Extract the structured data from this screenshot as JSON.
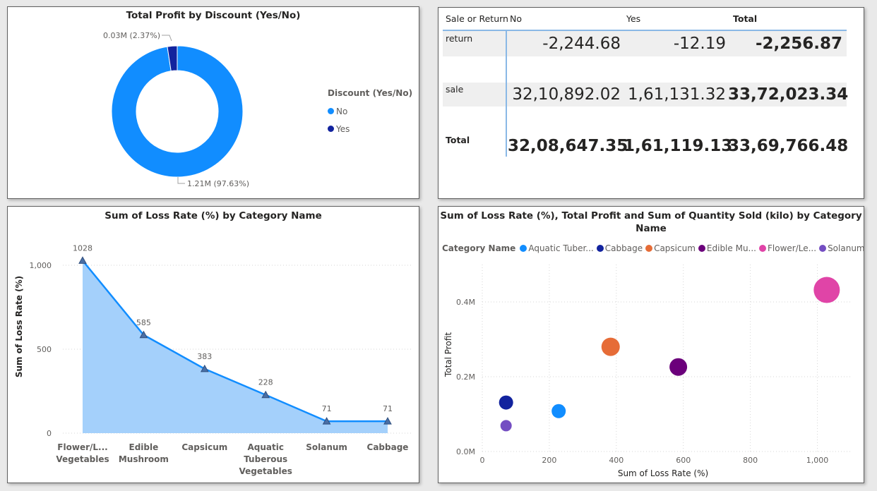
{
  "donut": {
    "title": "Total Profit by Discount (Yes/No)",
    "legend_title": "Discount (Yes/No)",
    "chart_data": {
      "type": "pie",
      "title": "Total Profit by Discount (Yes/No)",
      "legend_position": "right",
      "categories": [
        "No",
        "Yes"
      ],
      "values": [
        1.21,
        0.03
      ],
      "percent": [
        97.63,
        2.37
      ],
      "labels": [
        "1.21M (97.63%)",
        "0.03M (2.37%)"
      ],
      "colors": [
        "#118DFF",
        "#12239E"
      ]
    }
  },
  "matrix": {
    "header": [
      "Sale or Return",
      "No",
      "Yes",
      "Total"
    ],
    "rows": [
      {
        "label": "return",
        "cells": [
          "-2,244.68",
          "-12.19",
          "-2,256.87"
        ]
      },
      {
        "label": "sale",
        "cells": [
          "32,10,892.02",
          "1,61,131.32",
          "33,72,023.34"
        ]
      },
      {
        "label": "Total",
        "cells": [
          "32,08,647.35",
          "1,61,119.13",
          "33,69,766.48"
        ]
      }
    ]
  },
  "area": {
    "title": "Sum of Loss Rate (%) by Category Name",
    "chart_data": {
      "type": "area",
      "title": "Sum of Loss Rate (%) by Category Name",
      "ylabel": "Sum of Loss Rate (%)",
      "xlabel": "",
      "categories": [
        [
          "Flower/L...",
          "Vegetables"
        ],
        [
          "Edible",
          "Mushroom"
        ],
        [
          "Capsicum"
        ],
        [
          "Aquatic",
          "Tuberous",
          "Vegetables"
        ],
        [
          "Solanum"
        ],
        [
          "Cabbage"
        ]
      ],
      "values": [
        1028,
        585,
        383,
        228,
        71,
        71
      ],
      "data_labels": [
        "1028",
        "585",
        "383",
        "228",
        "71",
        "71"
      ],
      "ylim": [
        0,
        1000
      ],
      "yticks": [
        0,
        500,
        1000
      ],
      "ytick_labels": [
        "0",
        "500",
        "1,000"
      ],
      "grid": true,
      "line_color": "#118DFF",
      "fill_color": "#A4D0FB"
    }
  },
  "scatter": {
    "title_line1": "Sum of Loss Rate (%), Total Profit and Sum of Quantity Sold (kilo) by Category",
    "title_line2": "Name",
    "legend_title": "Category Name",
    "chart_data": {
      "type": "scatter",
      "title": "Sum of Loss Rate (%), Total Profit and Sum of Quantity Sold (kilo) by Category Name",
      "xlabel": "Sum of Loss Rate (%)",
      "ylabel": "Total Profit",
      "legend_position": "top-left",
      "xlim": [
        0,
        1100
      ],
      "ylim": [
        0,
        0.5
      ],
      "xticks": [
        0,
        200,
        400,
        600,
        800,
        1000
      ],
      "xtick_labels": [
        "0",
        "200",
        "400",
        "600",
        "800",
        "1,000"
      ],
      "yticks": [
        0,
        0.2,
        0.4
      ],
      "ytick_labels": [
        "0.0M",
        "0.2M",
        "0.4M"
      ],
      "grid": true,
      "series": [
        {
          "name": "Aquatic Tuber...",
          "x": 228,
          "y": 0.108,
          "size": 1.0,
          "color": "#118DFF"
        },
        {
          "name": "Cabbage",
          "x": 71,
          "y": 0.131,
          "size": 1.0,
          "color": "#12239E"
        },
        {
          "name": "Capsicum",
          "x": 383,
          "y": 0.28,
          "size": 1.3,
          "color": "#E66C37"
        },
        {
          "name": "Edible Mu...",
          "x": 585,
          "y": 0.226,
          "size": 1.25,
          "color": "#6B007B"
        },
        {
          "name": "Flower/Le...",
          "x": 1028,
          "y": 0.432,
          "size": 1.85,
          "color": "#E044A7"
        },
        {
          "name": "Solanum",
          "x": 71,
          "y": 0.069,
          "size": 0.8,
          "color": "#744EC2"
        }
      ]
    }
  }
}
